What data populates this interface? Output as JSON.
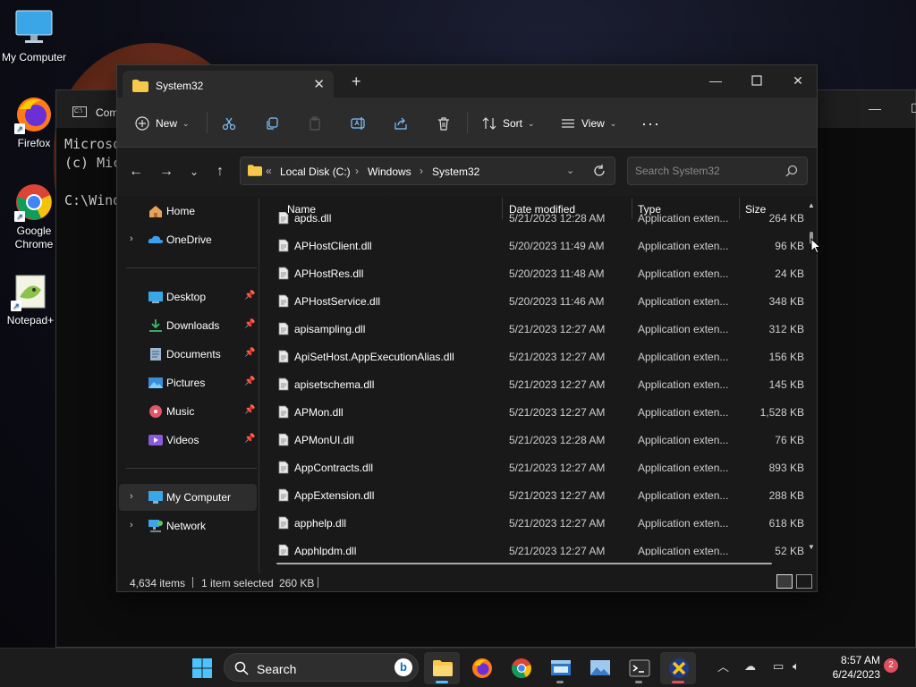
{
  "desktop": {
    "icons": [
      {
        "label": "My Computer"
      },
      {
        "label": "Firefox"
      },
      {
        "label": "Google Chrome"
      },
      {
        "label": "Notepad+"
      }
    ]
  },
  "terminal": {
    "tab_title": "Com",
    "lines": [
      "Microso",
      "(c) Mic",
      "",
      "C:\\Wind"
    ]
  },
  "explorer": {
    "tab_title": "System32",
    "toolbar": {
      "new_label": "New",
      "sort_label": "Sort",
      "view_label": "View",
      "more_label": "···"
    },
    "address": {
      "segments": [
        "Local Disk (C:)",
        "Windows",
        "System32"
      ],
      "overflow": "«"
    },
    "search_placeholder": "Search System32",
    "nav": {
      "home": "Home",
      "onedrive": "OneDrive",
      "pinned": [
        "Desktop",
        "Downloads",
        "Documents",
        "Pictures",
        "Music",
        "Videos"
      ],
      "my_computer": "My Computer",
      "network": "Network"
    },
    "columns": {
      "name": "Name",
      "date": "Date modified",
      "type": "Type",
      "size": "Size"
    },
    "files": [
      {
        "name": "apds.dll",
        "date": "5/21/2023 12:28 AM",
        "type": "Application exten...",
        "size": "264 KB"
      },
      {
        "name": "APHostClient.dll",
        "date": "5/20/2023 11:49 AM",
        "type": "Application exten...",
        "size": "96 KB"
      },
      {
        "name": "APHostRes.dll",
        "date": "5/20/2023 11:48 AM",
        "type": "Application exten...",
        "size": "24 KB"
      },
      {
        "name": "APHostService.dll",
        "date": "5/20/2023 11:46 AM",
        "type": "Application exten...",
        "size": "348 KB"
      },
      {
        "name": "apisampling.dll",
        "date": "5/21/2023 12:27 AM",
        "type": "Application exten...",
        "size": "312 KB"
      },
      {
        "name": "ApiSetHost.AppExecutionAlias.dll",
        "date": "5/21/2023 12:27 AM",
        "type": "Application exten...",
        "size": "156 KB"
      },
      {
        "name": "apisetschema.dll",
        "date": "5/21/2023 12:27 AM",
        "type": "Application exten...",
        "size": "145 KB"
      },
      {
        "name": "APMon.dll",
        "date": "5/21/2023 12:27 AM",
        "type": "Application exten...",
        "size": "1,528 KB"
      },
      {
        "name": "APMonUI.dll",
        "date": "5/21/2023 12:28 AM",
        "type": "Application exten...",
        "size": "76 KB"
      },
      {
        "name": "AppContracts.dll",
        "date": "5/21/2023 12:27 AM",
        "type": "Application exten...",
        "size": "893 KB"
      },
      {
        "name": "AppExtension.dll",
        "date": "5/21/2023 12:27 AM",
        "type": "Application exten...",
        "size": "288 KB"
      },
      {
        "name": "apphelp.dll",
        "date": "5/21/2023 12:27 AM",
        "type": "Application exten...",
        "size": "618 KB"
      },
      {
        "name": "Apphlpdm.dll",
        "date": "5/21/2023 12:27 AM",
        "type": "Application exten...",
        "size": "52 KB"
      }
    ],
    "status": {
      "item_count": "4,634 items",
      "selection": "1 item selected",
      "selection_size": "260 KB"
    }
  },
  "taskbar": {
    "search_label": "Search",
    "time": "8:57 AM",
    "date": "6/24/2023",
    "notification_count": "2"
  }
}
